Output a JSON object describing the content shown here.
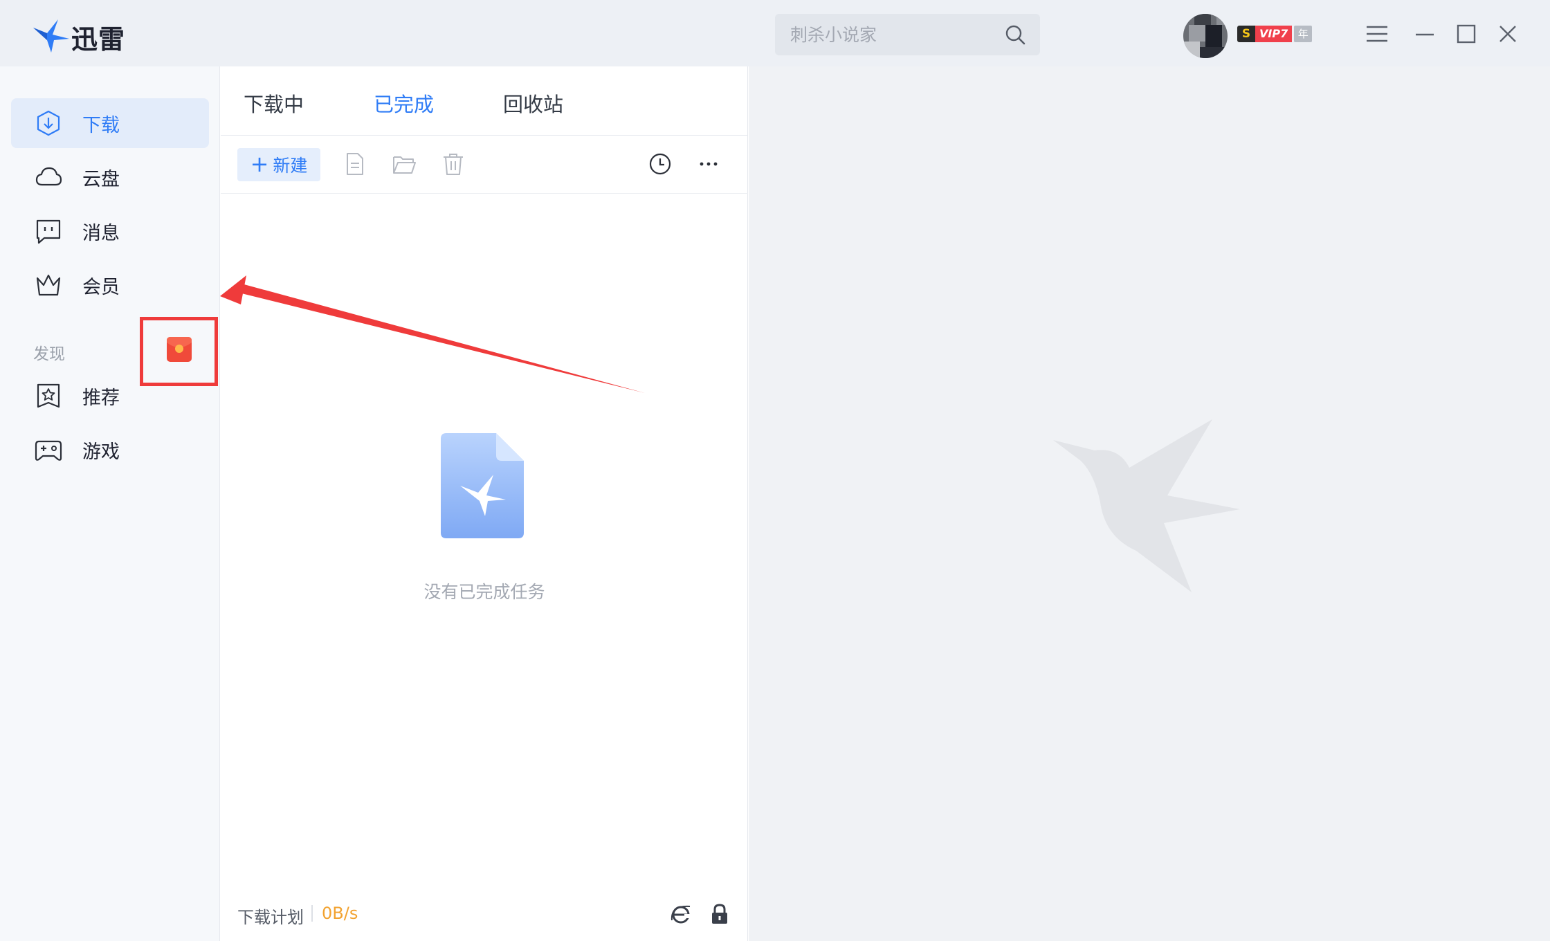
{
  "titlebar": {
    "app_name": "迅雷",
    "search": {
      "placeholder": "刺杀小说家",
      "value": ""
    },
    "vip": {
      "level_label": "VIP7",
      "s_mark": "S",
      "period_label": "年"
    },
    "window_buttons": [
      "menu-icon",
      "minimize-icon",
      "maximize-icon",
      "close-icon"
    ]
  },
  "sidebar": {
    "items": [
      {
        "label": "下载",
        "icon": "download-icon",
        "active": true
      },
      {
        "label": "云盘",
        "icon": "cloud-icon"
      },
      {
        "label": "消息",
        "icon": "message-icon"
      },
      {
        "label": "会员",
        "icon": "crown-icon"
      }
    ],
    "discover_label": "发现",
    "discover_items": [
      {
        "label": "推荐",
        "icon": "star-bookmark-icon"
      },
      {
        "label": "游戏",
        "icon": "gamepad-icon"
      }
    ]
  },
  "list": {
    "tabs": [
      {
        "label": "下载中"
      },
      {
        "label": "已完成",
        "active": true
      },
      {
        "label": "回收站"
      }
    ],
    "toolbar": {
      "new_label": "新建"
    },
    "empty_text": "没有已完成任务",
    "footer": {
      "plan_label": "下载计划",
      "speed": "0B/s"
    }
  },
  "colors": {
    "accent": "#2f7cf6",
    "highlight_border": "#ef3b3b",
    "speed": "#f2a22f",
    "vip_red": "#f0404c"
  }
}
